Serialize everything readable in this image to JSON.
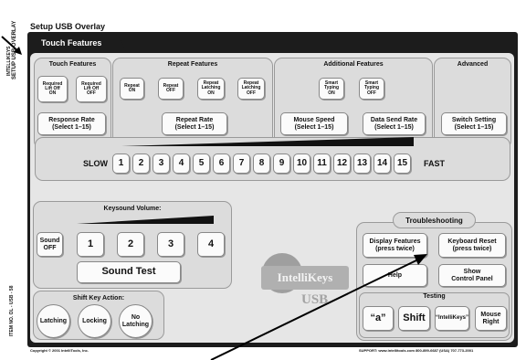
{
  "side": {
    "label_top": "INTELLIKEYS",
    "label_bottom": "SETUP USB OVERLAY",
    "item_code": "ITEM NO. OL - USB - 58"
  },
  "window": {
    "title": "Setup USB Overlay",
    "tab": "Touch Features"
  },
  "touch_features": {
    "title": "Touch Features",
    "required_lift_off_on": "Required\nLift Off\nON",
    "required_lift_off_off": "Required\nLift Off\nOFF",
    "response_rate": "Response Rate\n(Select 1–15)"
  },
  "repeat_features": {
    "title": "Repeat Features",
    "repeat_on": "Repeat\nON",
    "repeat_off": "Repeat\nOFF",
    "repeat_latching_on": "Repeat\nLatching\nON",
    "repeat_latching_off": "Repeat\nLatching\nOFF",
    "repeat_rate": "Repeat Rate\n(Select 1–15)"
  },
  "additional_features": {
    "title": "Additional Features",
    "smart_typing_on": "Smart\nTyping\nON",
    "smart_typing_off": "Smart\nTyping\nOFF",
    "mouse_speed": "Mouse Speed\n(Select 1–15)",
    "data_send_rate": "Data Send Rate\n(Select 1–15)"
  },
  "advanced": {
    "title": "Advanced",
    "switch_setting": "Switch Setting\n(Select 1–15)"
  },
  "speed": {
    "slow": "SLOW",
    "fast": "FAST",
    "numbers": [
      "1",
      "2",
      "3",
      "4",
      "5",
      "6",
      "7",
      "8",
      "9",
      "10",
      "11",
      "12",
      "13",
      "14",
      "15"
    ]
  },
  "keysound": {
    "title": "Keysound Volume:",
    "sound_off": "Sound\nOFF",
    "levels": [
      "1",
      "2",
      "3",
      "4"
    ],
    "sound_test": "Sound Test"
  },
  "shift_key": {
    "title": "Shift Key Action:",
    "latching": "Latching",
    "locking": "Locking",
    "no_latching": "No\nLatching"
  },
  "logo": {
    "brand": "IntelliKeys",
    "usb": "USB"
  },
  "troubleshooting": {
    "title": "Troubleshooting",
    "display_features": "Display Features\n(press twice)",
    "keyboard_reset": "Keyboard Reset\n(press twice)",
    "help": "Help",
    "show_control_panel": "Show\nControl Panel",
    "testing_title": "Testing",
    "test_a": "“a”",
    "test_shift": "Shift",
    "test_intellikeys": "“IntelliKeys”",
    "test_mouse_right": "Mouse\nRight"
  },
  "footer": {
    "copyright": "Copyright © 2001 IntelliTools, Inc.",
    "support": "SUPPORT:   www.intellitools.com   800-899-6687 (USA)   707-773-2001"
  }
}
